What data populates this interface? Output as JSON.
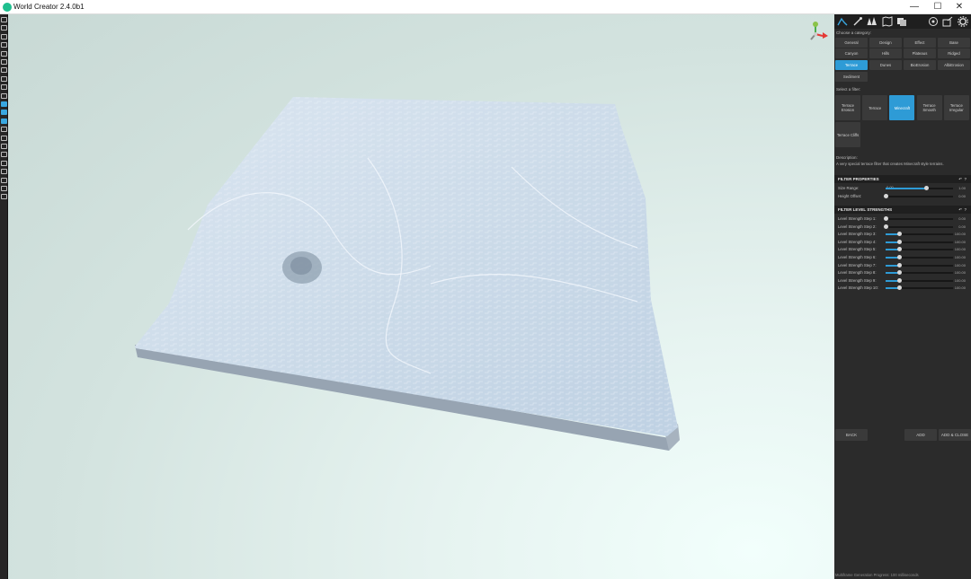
{
  "window": {
    "title": "World Creator 2.4.0b1",
    "controls": [
      "—",
      "☐",
      "✕"
    ]
  },
  "toolbar": {
    "tools": [
      "new-file-icon",
      "open-folder-icon",
      "save-icon",
      "save-as-icon",
      "print-icon",
      "import-icon",
      "export-icon",
      "map-icon",
      "layers-icon",
      "globe-icon",
      "terrain-icon",
      "brush-icon",
      "water-icon",
      "erosion-icon",
      "mountain-icon",
      "move-icon",
      "grid-icon",
      "image-icon",
      "sky-icon",
      "settings-icon",
      "tree-icon",
      "tools-icon"
    ]
  },
  "panel": {
    "top_icons": [
      "terrain-icon",
      "brush-icon",
      "forest-icon",
      "map-icon",
      "layers-icon",
      "camera-icon",
      "share-icon",
      "gear-icon"
    ],
    "category_label": "Choose a category:",
    "categories": [
      "General",
      "Design",
      "Effect",
      "Base",
      "Canyon",
      "Hills",
      "Plateaus",
      "Ridged",
      "Terrace",
      "Dunes",
      "BioErosion",
      "AlbiErosion",
      "Sediment"
    ],
    "active_category": "Terrace",
    "filter_label": "Select a filter:",
    "filters": [
      "Terrace Erosion",
      "Terrace",
      "Minecraft",
      "Terrace Smooth",
      "Terrace Irregular",
      "Terrace Cliffs"
    ],
    "active_filter": "Minecraft",
    "description_label": "Description:",
    "description_text": "A very special terrace filter that creates Minecraft style terrains.",
    "properties_header": "FILTER PROPERTIES",
    "properties": [
      {
        "label": "Size Range:",
        "min": "0.00",
        "value": "1.00",
        "fraction": 0.6
      },
      {
        "label": "Height Offset:",
        "value": "0.00",
        "fraction": 0.0
      }
    ],
    "strengths_header": "FILTER LEVEL STRENGTHS",
    "header_icons": [
      "↶",
      "?"
    ],
    "strengths": [
      {
        "label": "Level Strength Step 1:",
        "value": "0.00",
        "fraction": 0.0
      },
      {
        "label": "Level Strength Step 2:",
        "value": "0.00",
        "fraction": 0.0
      },
      {
        "label": "Level Strength Step 3:",
        "value": "100.00",
        "fraction": 0.2
      },
      {
        "label": "Level Strength Step 4:",
        "value": "100.00",
        "fraction": 0.2
      },
      {
        "label": "Level Strength Step 5:",
        "value": "100.00",
        "fraction": 0.2
      },
      {
        "label": "Level Strength Step 6:",
        "value": "100.00",
        "fraction": 0.2
      },
      {
        "label": "Level Strength Step 7:",
        "value": "100.00",
        "fraction": 0.2
      },
      {
        "label": "Level Strength Step 8:",
        "value": "100.00",
        "fraction": 0.2
      },
      {
        "label": "Level Strength Step 9:",
        "value": "100.00",
        "fraction": 0.2
      },
      {
        "label": "Level Strength Step 10:",
        "value": "100.00",
        "fraction": 0.2
      }
    ],
    "back_label": "BACK",
    "add_label": "ADD",
    "add_close_label": "ADD & CLOSE"
  },
  "status": {
    "text": "Multiframe Generation Progress: 100 milliseconds"
  },
  "colors": {
    "accent": "#2e9bd6",
    "panel_bg": "#2b2b2b",
    "terrain_top": "#c9dbeb",
    "terrain_side": "#8f9caa"
  }
}
